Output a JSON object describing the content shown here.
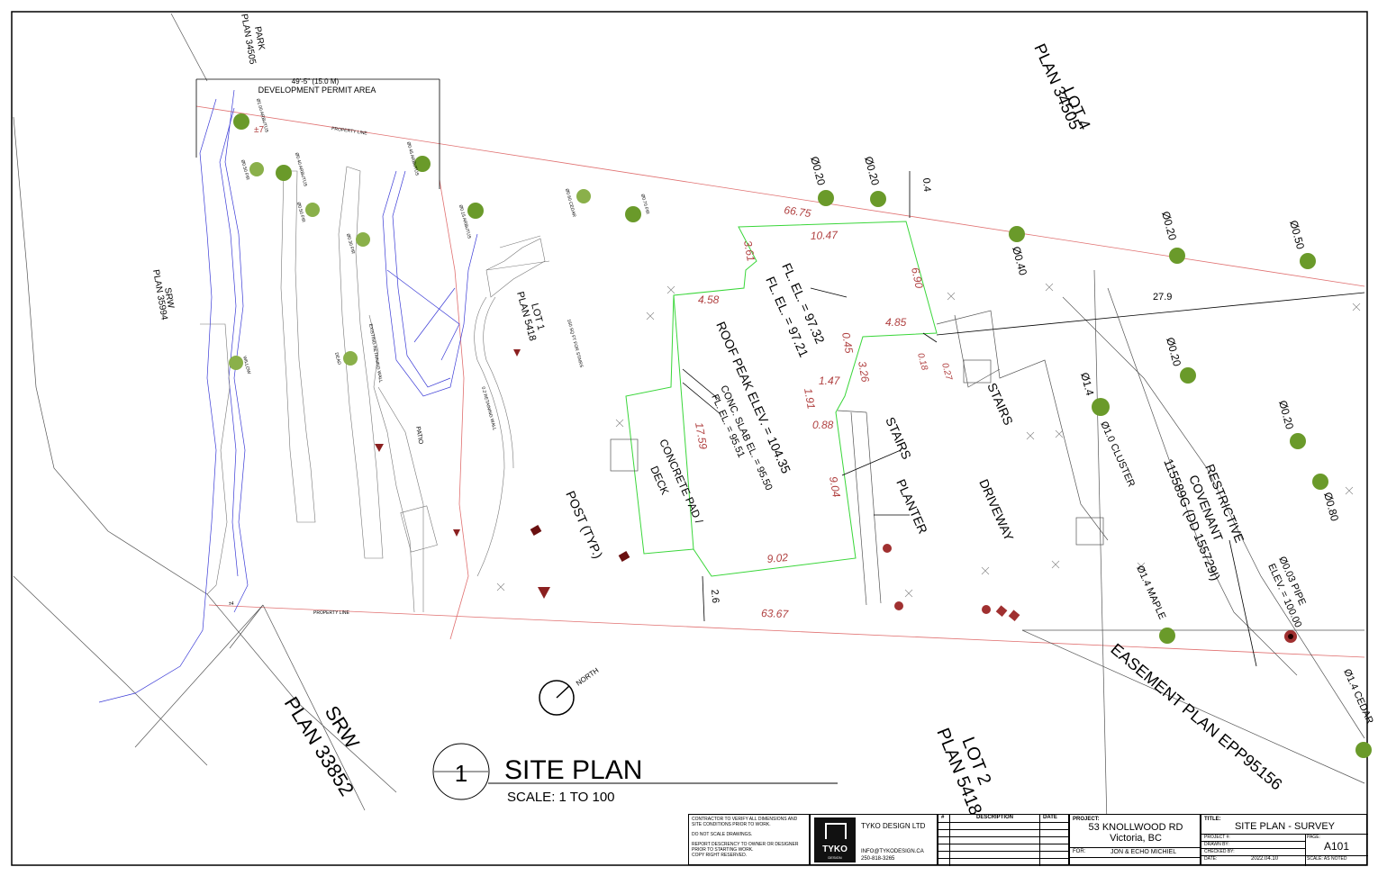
{
  "drawing": {
    "number": "1",
    "title": "SITE PLAN",
    "scale": "SCALE: 1 TO 100"
  },
  "labels": {
    "lot4": "LOT 4",
    "lot4_plan": "PLAN 34505",
    "park": "PARK",
    "park_plan": "PLAN 34505",
    "srw_west": "SRW",
    "srw_west_plan": "PLAN 35994",
    "srw_south": "SRW",
    "srw_south_plan": "PLAN 33852",
    "lot2": "LOT 2",
    "lot2_plan": "PLAN 5418",
    "lot1": "LOT 1",
    "lot1_plan": "PLAN 5418",
    "easement": "EASEMENT PLAN EPP95156",
    "restrictive1": "RESTRICTIVE",
    "restrictive2": "COVENANT",
    "restrictive3": "115589G (DD 155729I)",
    "dev_dim": "49'-5\" (15.0 M)",
    "dev_area": "DEVELOPMENT PERMIT AREA",
    "property_line": "PROPERTY LINE",
    "property_line2": "PROPERTY LINE",
    "patio": "PATIO",
    "existing_wall": "EXISTING RETAINING WALL",
    "retaining_wall": "0.2 RETAINING WALL",
    "stairs_sqft": "160 SQ FT FOR STAIRS",
    "fl_el1": "FL. EL. = 97.32",
    "fl_el2": "FL. EL. = 97.21",
    "roof_peak": "ROOF PEAK ELEV. = 104.35",
    "slab_el": "CONC. SLAB EL. = 95.50",
    "fl_el3": "FL. EL. = 95.51",
    "concrete1": "CONCRETE PAD /",
    "concrete2": "DECK",
    "post": "POST (TYP.)",
    "stairs1": "STAIRS",
    "stairs2": "STAIRS",
    "planter": "PLANTER",
    "driveway": "DRIVEWAY",
    "cluster": "Ø1.0 CLUSTER",
    "maple": "Ø1.4 MAPLE",
    "pipe1": "Ø0.03 PIPE",
    "pipe2": "ELEV. = 100.00",
    "cedar_right": "Ø1.4 CEDAR",
    "north": "NORTH",
    "d1447": "±7",
    "d14": "±4"
  },
  "dimensions": {
    "d6675": "66.75",
    "d1047": "10.47",
    "d361": "3.61",
    "d458": "4.58",
    "d690": "6.90",
    "d485": "4.85",
    "d045": "0.45",
    "d326": "3.26",
    "d147": "1.47",
    "d191": "1.91",
    "d088": "0.88",
    "d1759": "17.59",
    "d904": "9.04",
    "d902": "9.02",
    "d6367": "63.67",
    "d26": "2.6",
    "d04": "0.4",
    "d279": "27.9",
    "d018": "0.18",
    "d027": "0.27"
  },
  "trees": {
    "t020a": "Ø0.20",
    "t020b": "Ø0.20",
    "t040": "Ø0.40",
    "t020c": "Ø0.20",
    "t050": "Ø0.50",
    "t020d": "Ø0.20",
    "t14": "Ø1.4",
    "t020e": "Ø0.20",
    "t080": "Ø0.80",
    "arbutus": "Ø1.00 ARBUTUS",
    "fir1": "Ø0.50 FIR",
    "arbutus2": "Ø0.40 ARBUTUS",
    "fir2": "Ø0.50 FIR",
    "fir3": "Ø0.30 FIR",
    "arbutus3": "Ø0.45 ARBUTUS",
    "arbutus4": "Ø0.15 ARBUTUS",
    "cedar": "Ø0.60 CEDAR",
    "fir4": "Ø0.70 FIR",
    "willow": "WILLOW",
    "dead": "DEAD"
  },
  "titleblock": {
    "notes1": "CONTRACTOR TO VERIFY ALL DIMENSIONS AND SITE CONDITIONS PRIOR TO WORK.",
    "notes2": "DO NOT SCALE DRAWINGS.",
    "notes3": "REPORT DESCRENCY TO OWNER OR DESIGNER PRIOR TO STARTING WORK.",
    "notes4": "COPY RIGHT RESERVED.",
    "logo_text": "TYKO",
    "logo_sub": "DESIGN",
    "company": "TYKO DESIGN LTD",
    "email": "INFO@TYKODESIGN.CA",
    "phone": "250-818-3265",
    "rev_hash": "#",
    "rev_desc": "DESCRIPTION",
    "rev_date": "DATE",
    "project_label": "PROJECT:",
    "project_address": "53 KNOLLWOOD RD",
    "project_city": "Victoria, BC",
    "for_label": "FOR:",
    "client": "JON & ECHO MICHIEL",
    "title_label": "TITLE:",
    "title": "SITE PLAN - SURVEY",
    "project_no_label": "PROJECT #:",
    "drawn_label": "DRAWN BY:",
    "checked_label": "CHECKED BY:",
    "date_label": "DATE:",
    "date": "2022.04.10",
    "page_label": "PAGE:",
    "page": "A101",
    "scale_label": "SCALE:",
    "scale": "AS NOTED"
  },
  "colors": {
    "property_line": "#e07070",
    "building": "#39d639",
    "dimension_red": "#b04040",
    "contour_blue": "#3a3ad6",
    "tree_green": "#6a9a2a"
  }
}
